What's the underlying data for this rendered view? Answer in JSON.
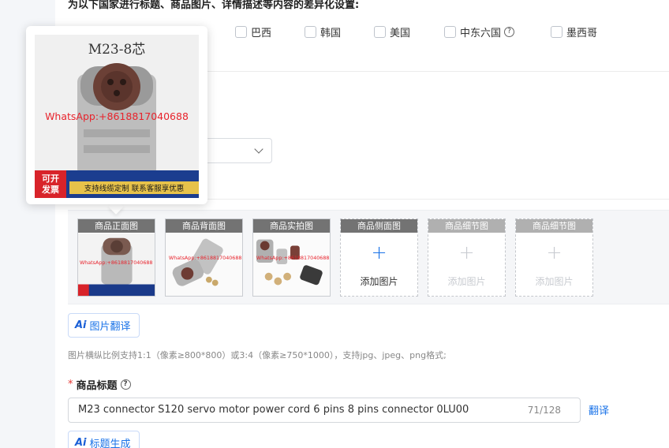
{
  "heading": "为以下国家进行标题、商品图片、详情描述等内容的差异化设置:",
  "countries": [
    {
      "label": "巴西"
    },
    {
      "label": "韩国"
    },
    {
      "label": "美国"
    },
    {
      "label": "中东六国"
    },
    {
      "label": "墨西哥"
    }
  ],
  "image_slots": [
    {
      "label": "商品正面图",
      "state": "filled"
    },
    {
      "label": "商品背面图",
      "state": "filled"
    },
    {
      "label": "商品实拍图",
      "state": "filled"
    },
    {
      "label": "商品侧面图",
      "state": "empty",
      "add_label": "添加图片"
    },
    {
      "label": "商品细节图",
      "state": "disabled",
      "add_label": "添加图片"
    },
    {
      "label": "商品细节图",
      "state": "disabled",
      "add_label": "添加图片"
    }
  ],
  "thumb_watermark": "WhatsApp:+8618817040688",
  "ai_badge": "Ai",
  "image_translate_label": "图片翻译",
  "image_hint": "图片横纵比例支持1:1（像素≥800*800）或3:4（像素≥750*1000），支持jpg、jpeg、png格式;",
  "title_field": {
    "required_mark": "*",
    "label": "商品标题",
    "value": "M23 connector S120 servo motor power cord 6 pins 8 pins connector 0LU00",
    "counter": "71/128",
    "translate_label": "翻译"
  },
  "title_generate_label": "标题生成",
  "popover": {
    "product_title": "M23-8芯",
    "watermark": "WhatsApp:+8618817040688",
    "badge_line1": "可开",
    "badge_line2": "发票",
    "banner_text": "支持线缆定制  联系客服享优惠"
  },
  "icons": {
    "help": "question-circle-icon",
    "plus": "plus-icon",
    "select": "chevron-down-icon"
  },
  "colors": {
    "accent": "#1a73e8",
    "required": "#e53935",
    "watermark": "#e8232c"
  }
}
